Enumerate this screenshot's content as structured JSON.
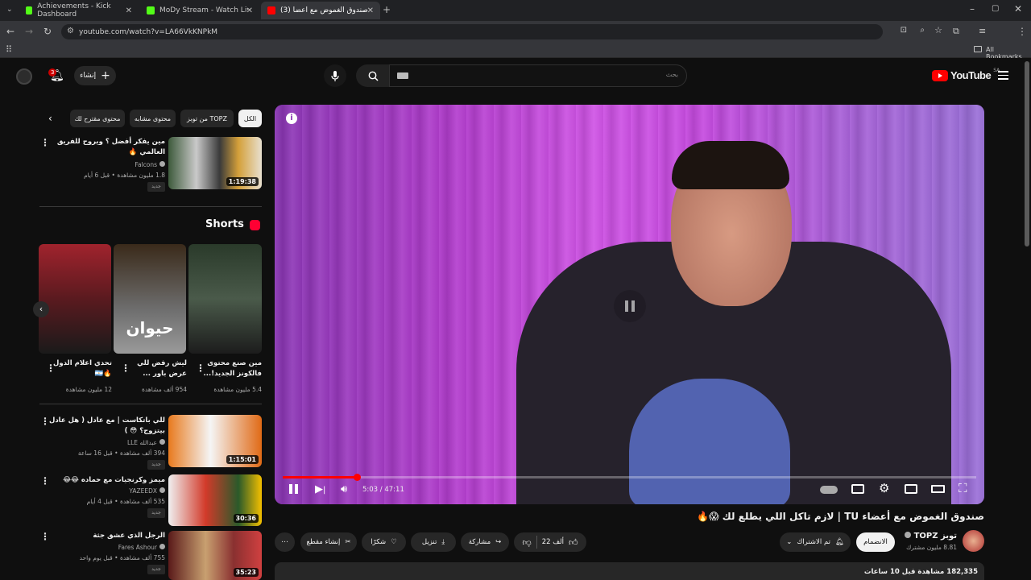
{
  "browser": {
    "tabs": [
      {
        "title": "Achievements - Kick Dashboard",
        "color": "#53fc18"
      },
      {
        "title": "MoDy Stream - Watch Live on K",
        "color": "#53fc18"
      },
      {
        "title": "(3) صندوق الغموض مع أعضا",
        "color": "#ff0000"
      }
    ],
    "url": "youtube.com/watch?v=LA66VkKNPkM",
    "bookmarks_label": "All Bookmarks"
  },
  "header": {
    "create_label": "إنشاء",
    "notification_count": "3",
    "search_placeholder": "بحث",
    "logo_text": "YouTube",
    "region": "SA"
  },
  "chips": [
    "الكل",
    "من توبز TOPZ",
    "محتوى مشابه",
    "محتوى مقترح لك"
  ],
  "sidebar_top_video": {
    "title": "مين يفكر أفضل ؟ ويروح للفريق العالمي 🔥",
    "channel": "Falcons",
    "meta": "1.8 مليون مشاهدة • قبل 6 أيام",
    "badge": "جديد",
    "duration": "1:19:38"
  },
  "shorts": {
    "heading": "Shorts",
    "items": [
      {
        "title": "تحدي اعلام الدول 🔥🇦🇷",
        "views": "12 مليون مشاهدة",
        "overlay": ""
      },
      {
        "title": "ليش رفض للي عرض باور ...",
        "views": "954 ألف مشاهدة",
        "overlay": "حيوان"
      },
      {
        "title": "مين صنع محتوى فالكونز الجديد!...",
        "views": "5.4 مليون مشاهدة",
        "overlay": ""
      }
    ]
  },
  "sidebar_videos": [
    {
      "title": "للي باتكاست | مع عادل ( هل عادل بيتزوج؟ 😳 )",
      "channel": "عبدالله LLE",
      "meta": "394 ألف مشاهدة • قبل 16 ساعة",
      "badge": "جديد",
      "duration": "1:15:01"
    },
    {
      "title": "ميمز وكرنجيات مع حماده 😂😂",
      "channel": "YAZEEDX",
      "meta": "535 ألف مشاهدة • قبل 4 أيام",
      "badge": "جديد",
      "duration": "30:36"
    },
    {
      "title": "الرجل الذي عشق جثة",
      "channel": "Fares Ashour",
      "meta": "755 ألف مشاهدة • قبل يوم واحد",
      "badge": "جديد",
      "duration": "35:23"
    }
  ],
  "player": {
    "time": "5:03 / 47:11",
    "progress_fraction": 0.107
  },
  "video": {
    "title": "صندوق الغموض مع أعضاء TU | لازم تاكل اللي يطلع لك 😱🔥",
    "channel": "توبز TOPZ",
    "subscribers": "8.81 مليون مشترك",
    "join_label": "الانضمام",
    "subscribed_label": "تم الاشتراك",
    "likes": "22 ألف",
    "share_label": "مشاركة",
    "download_label": "تنزيل",
    "thanks_label": "شكرًا",
    "clip_label": "إنشاء مقطع",
    "views": "182,335",
    "views_suffix": "مشاهدة",
    "time_ago": "قبل 10 ساعات"
  }
}
